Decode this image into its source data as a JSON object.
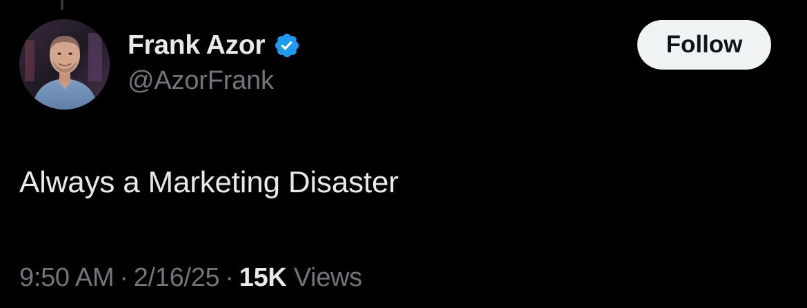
{
  "author": {
    "display_name": "Frank Azor",
    "handle": "@AzorFrank",
    "verified": true,
    "avatar_icon": "profile-photo"
  },
  "follow_button": {
    "label": "Follow"
  },
  "tweet": {
    "text": "Always a Marketing Disaster"
  },
  "meta": {
    "time": "9:50 AM",
    "separator": "·",
    "date": "2/16/25",
    "views_count": "15K",
    "views_label": "Views"
  },
  "colors": {
    "background": "#000000",
    "primary_text": "#e7e9ea",
    "secondary_text": "#71767b",
    "verified_blue": "#1d9bf0",
    "follow_button_bg": "#eff3f4"
  }
}
